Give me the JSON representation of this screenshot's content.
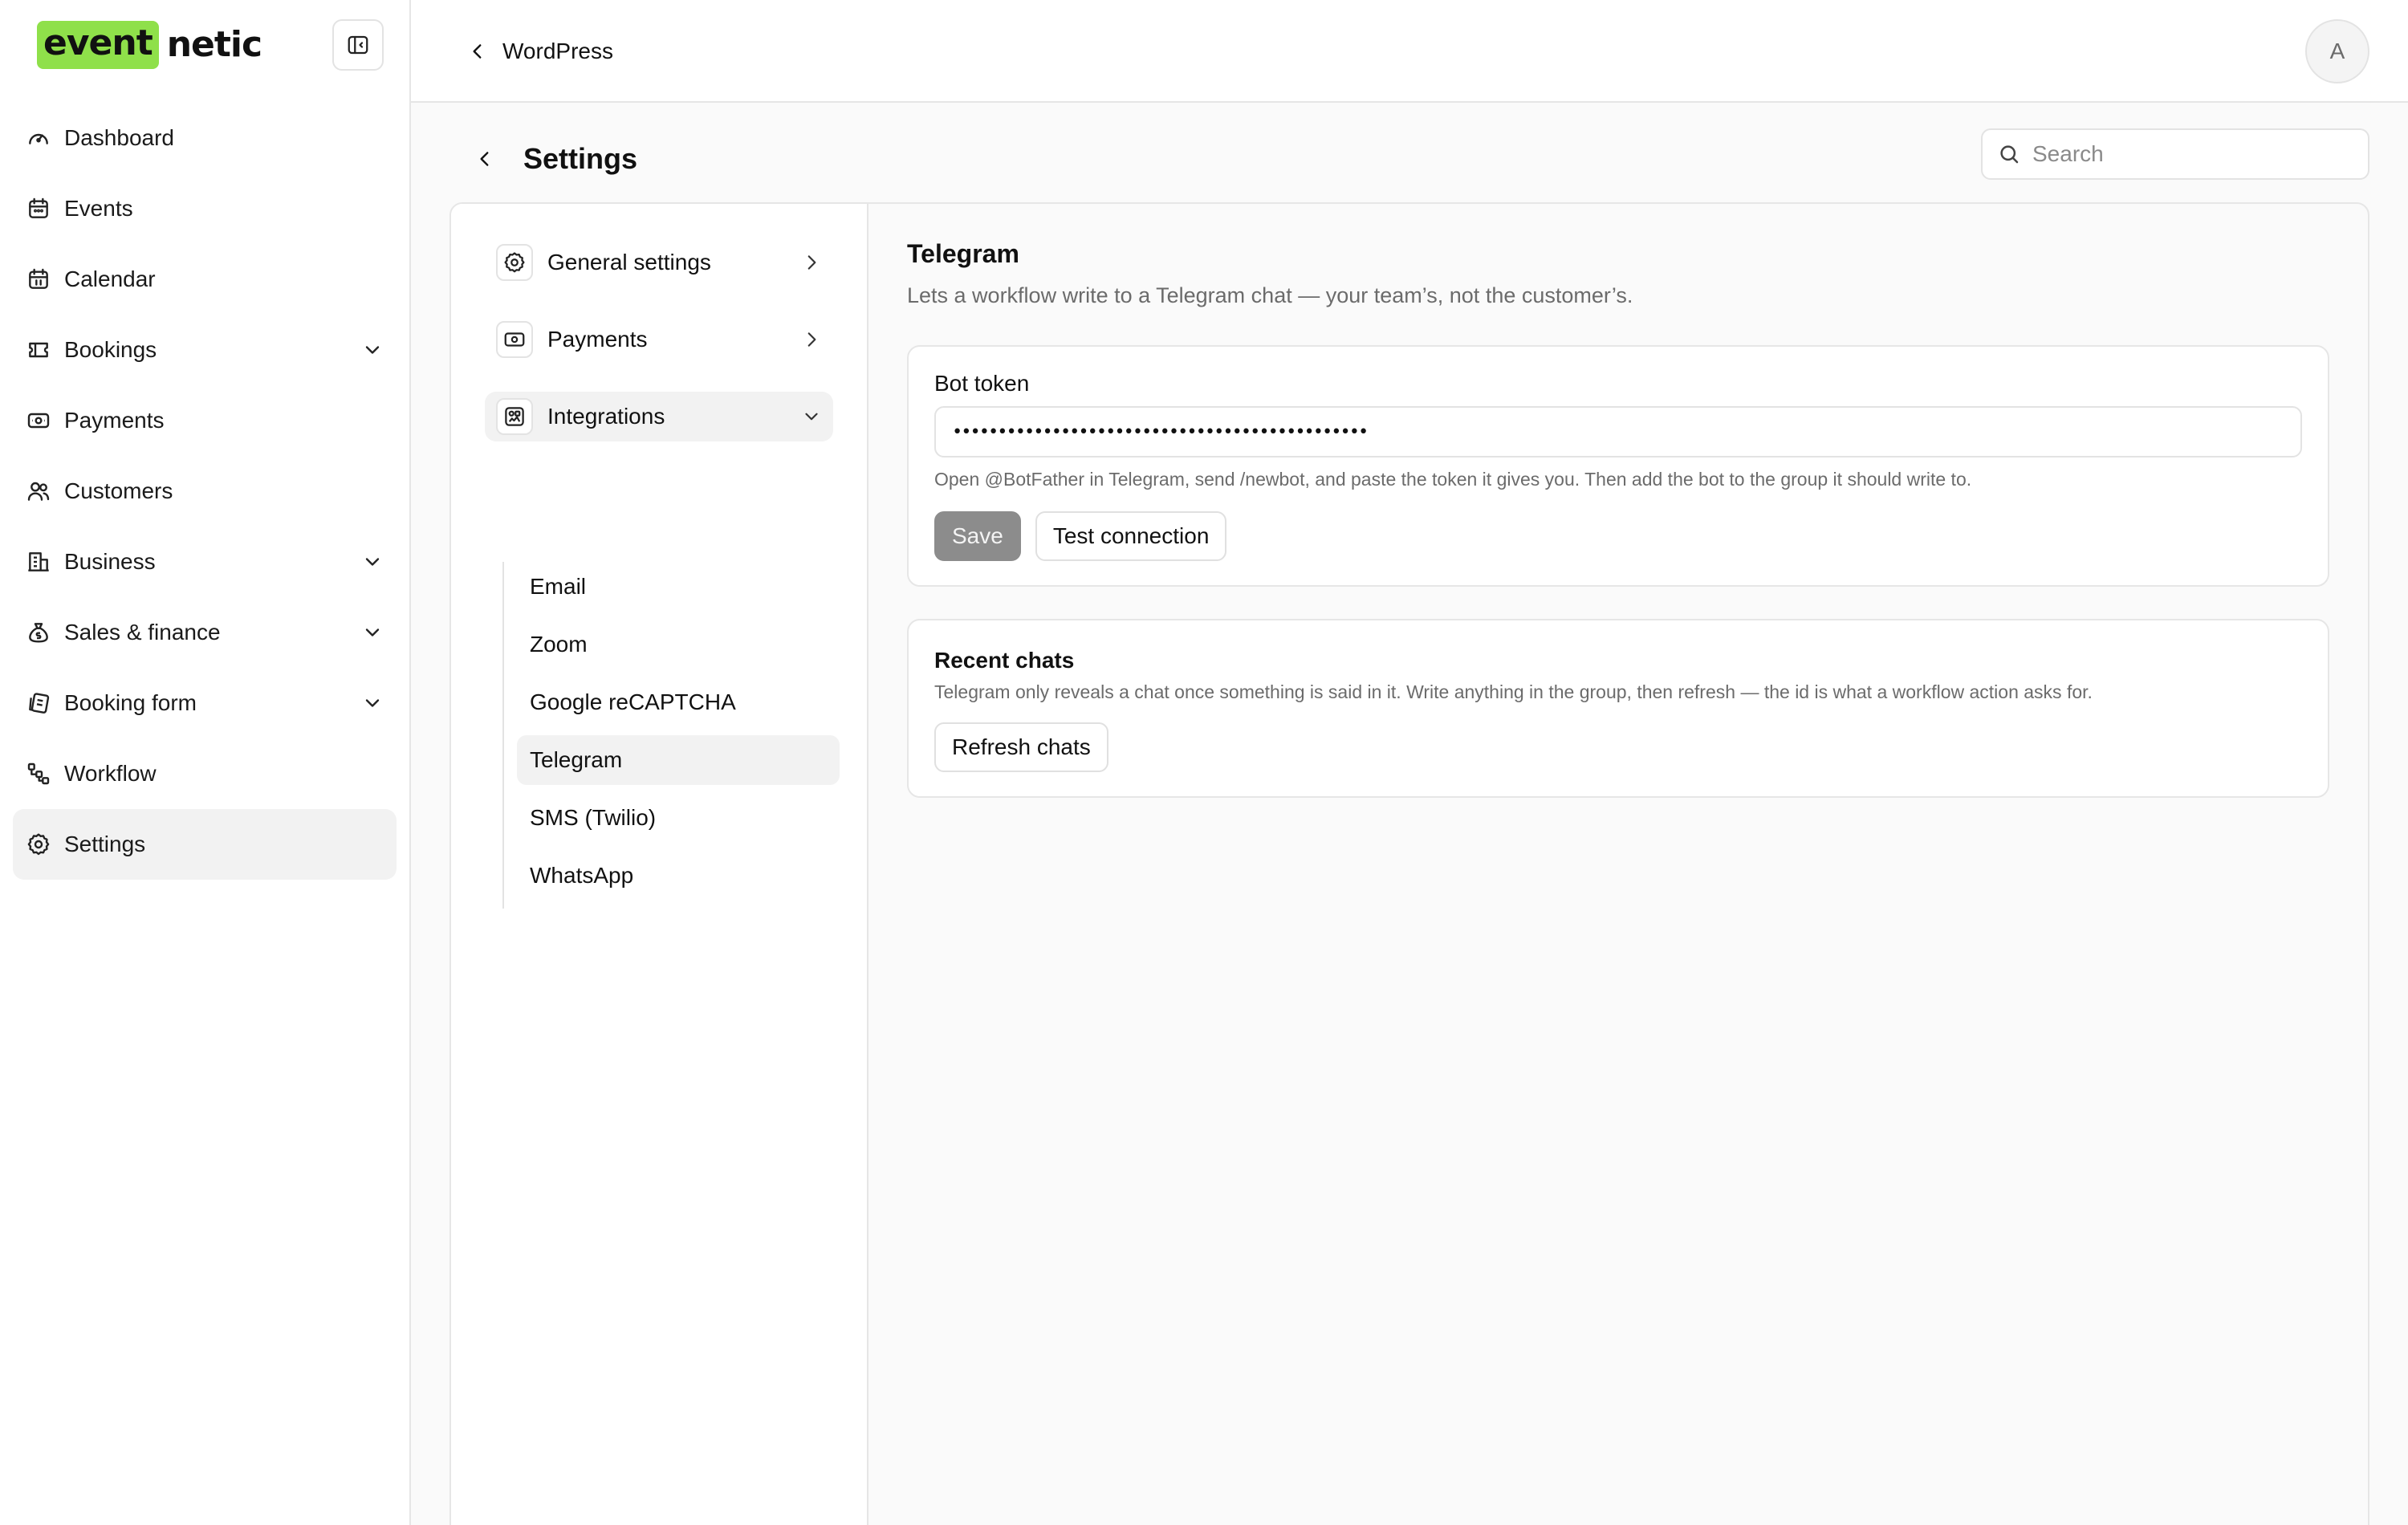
{
  "brand": {
    "logo_mark": "event",
    "logo_rest": "netic",
    "accent": "#8fe04a"
  },
  "sidebar": {
    "collapse_icon": "panel-collapse-icon",
    "items": [
      {
        "label": "Dashboard",
        "icon": "gauge-icon",
        "expandable": false,
        "active": false
      },
      {
        "label": "Events",
        "icon": "calendar-icon",
        "expandable": false,
        "active": false
      },
      {
        "label": "Calendar",
        "icon": "calendar-icon",
        "expandable": false,
        "active": false
      },
      {
        "label": "Bookings",
        "icon": "ticket-icon",
        "expandable": true,
        "active": false
      },
      {
        "label": "Payments",
        "icon": "banknote-icon",
        "expandable": false,
        "active": false
      },
      {
        "label": "Customers",
        "icon": "users-icon",
        "expandable": false,
        "active": false
      },
      {
        "label": "Business",
        "icon": "building-icon",
        "expandable": true,
        "active": false
      },
      {
        "label": "Sales & finance",
        "icon": "money-bag-icon",
        "expandable": true,
        "active": false
      },
      {
        "label": "Booking form",
        "icon": "form-icon",
        "expandable": true,
        "active": false
      },
      {
        "label": "Workflow",
        "icon": "workflow-icon",
        "expandable": false,
        "active": false
      },
      {
        "label": "Settings",
        "icon": "gear-icon",
        "expandable": false,
        "active": true
      }
    ]
  },
  "topbar": {
    "breadcrumb": "WordPress",
    "avatar_initial": "A"
  },
  "settings": {
    "title": "Settings",
    "search_placeholder": "Search",
    "subnav": {
      "general": "General settings",
      "payments": "Payments",
      "integrations": "Integrations",
      "children": [
        "Email",
        "Zoom",
        "Google reCAPTCHA",
        "Telegram",
        "SMS (Twilio)",
        "WhatsApp"
      ],
      "active_child": "Telegram"
    }
  },
  "telegram": {
    "title": "Telegram",
    "description": "Lets a workflow write to a Telegram chat — your team’s, not the customer’s.",
    "bot_token_label": "Bot token",
    "bot_token_value": "••••••••••••••••••••••••••••••••••••••••••••••",
    "help_text": "Open @BotFather in Telegram, send /newbot, and paste the token it gives you. Then add the bot to the group it should write to.",
    "save_label": "Save",
    "test_label": "Test connection",
    "recent_title": "Recent chats",
    "recent_desc": "Telegram only reveals a chat once something is said in it. Write anything in the group, then refresh — the id is what a workflow action asks for.",
    "refresh_label": "Refresh chats"
  }
}
